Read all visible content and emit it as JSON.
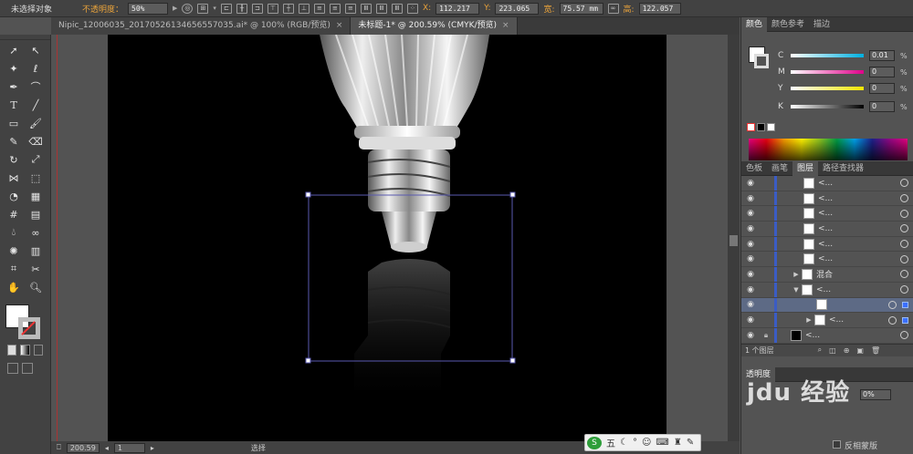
{
  "control": {
    "selection": "未选择对象",
    "opacity_label": "不透明度：",
    "opacity_value": "50%",
    "x_label": "X:",
    "x_value": "112.217",
    "y_label": "Y:",
    "y_value": "223.065",
    "w_label": "宽:",
    "w_value": "75.57 mm",
    "h_label": "高:",
    "h_value": "122.057"
  },
  "tabs": [
    {
      "label": "Nipic_12006035_20170526134656557035.ai* @ 100% (RGB/预览)"
    },
    {
      "label": "未标题-1* @ 200.59% (CMYK/预览)"
    }
  ],
  "status": {
    "zoom": "200.59",
    "page": "1",
    "mode": "选择"
  },
  "ime": {
    "label": "五"
  },
  "color_panel": {
    "tabs": [
      "颜色",
      "颜色参考",
      "描边"
    ],
    "channels": [
      {
        "name": "C",
        "value": "0.01",
        "color": "#00b0e0"
      },
      {
        "name": "M",
        "value": "0",
        "color": "#e0008a"
      },
      {
        "name": "Y",
        "value": "0",
        "color": "#f5e600"
      },
      {
        "name": "K",
        "value": "0",
        "color": "#000000"
      }
    ],
    "unit": "%"
  },
  "layers_panel": {
    "tabs": [
      "色板",
      "画笔",
      "图层",
      "路径查找器"
    ],
    "rows": [
      {
        "name": "<...",
        "selected": false
      },
      {
        "name": "<...",
        "selected": false
      },
      {
        "name": "<...",
        "selected": false
      },
      {
        "name": "<...",
        "selected": false
      },
      {
        "name": "<...",
        "selected": false
      },
      {
        "name": "<...",
        "selected": false
      },
      {
        "name": "混合",
        "selected": false
      },
      {
        "name": "<...",
        "selected": false
      },
      {
        "name": "",
        "selected": true
      },
      {
        "name": "<...",
        "selected": false
      },
      {
        "name": "<...",
        "selected": false
      }
    ],
    "footer": "1 个图层"
  },
  "lower_panel": {
    "partial_label": "透明度",
    "opacity": "0%",
    "checkbox_label": "反相蒙版"
  },
  "watermark": "jdu 经验"
}
